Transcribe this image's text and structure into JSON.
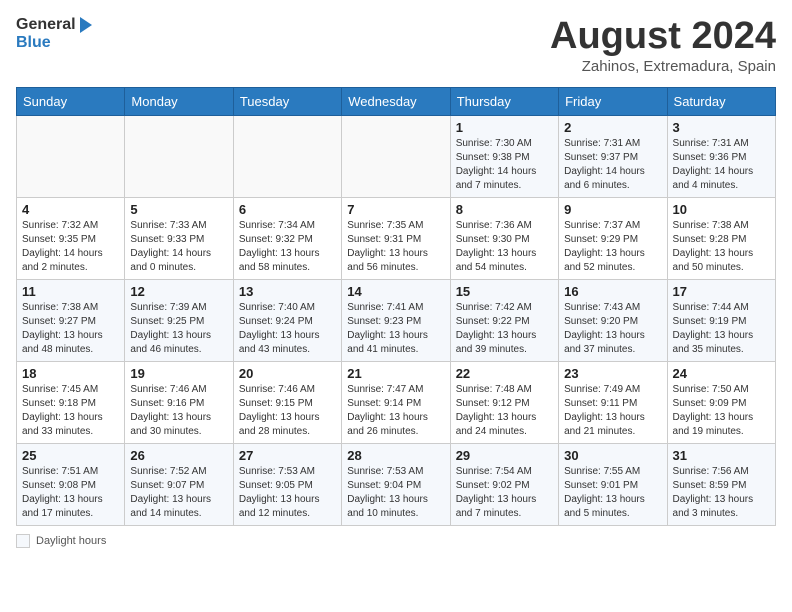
{
  "logo": {
    "general": "General",
    "blue": "Blue"
  },
  "title": {
    "month_year": "August 2024",
    "location": "Zahinos, Extremadura, Spain"
  },
  "days_of_week": [
    "Sunday",
    "Monday",
    "Tuesday",
    "Wednesday",
    "Thursday",
    "Friday",
    "Saturday"
  ],
  "weeks": [
    [
      {
        "day": "",
        "sunrise": "",
        "sunset": "",
        "daylight": ""
      },
      {
        "day": "",
        "sunrise": "",
        "sunset": "",
        "daylight": ""
      },
      {
        "day": "",
        "sunrise": "",
        "sunset": "",
        "daylight": ""
      },
      {
        "day": "",
        "sunrise": "",
        "sunset": "",
        "daylight": ""
      },
      {
        "day": "1",
        "sunrise": "Sunrise: 7:30 AM",
        "sunset": "Sunset: 9:38 PM",
        "daylight": "Daylight: 14 hours and 7 minutes."
      },
      {
        "day": "2",
        "sunrise": "Sunrise: 7:31 AM",
        "sunset": "Sunset: 9:37 PM",
        "daylight": "Daylight: 14 hours and 6 minutes."
      },
      {
        "day": "3",
        "sunrise": "Sunrise: 7:31 AM",
        "sunset": "Sunset: 9:36 PM",
        "daylight": "Daylight: 14 hours and 4 minutes."
      }
    ],
    [
      {
        "day": "4",
        "sunrise": "Sunrise: 7:32 AM",
        "sunset": "Sunset: 9:35 PM",
        "daylight": "Daylight: 14 hours and 2 minutes."
      },
      {
        "day": "5",
        "sunrise": "Sunrise: 7:33 AM",
        "sunset": "Sunset: 9:33 PM",
        "daylight": "Daylight: 14 hours and 0 minutes."
      },
      {
        "day": "6",
        "sunrise": "Sunrise: 7:34 AM",
        "sunset": "Sunset: 9:32 PM",
        "daylight": "Daylight: 13 hours and 58 minutes."
      },
      {
        "day": "7",
        "sunrise": "Sunrise: 7:35 AM",
        "sunset": "Sunset: 9:31 PM",
        "daylight": "Daylight: 13 hours and 56 minutes."
      },
      {
        "day": "8",
        "sunrise": "Sunrise: 7:36 AM",
        "sunset": "Sunset: 9:30 PM",
        "daylight": "Daylight: 13 hours and 54 minutes."
      },
      {
        "day": "9",
        "sunrise": "Sunrise: 7:37 AM",
        "sunset": "Sunset: 9:29 PM",
        "daylight": "Daylight: 13 hours and 52 minutes."
      },
      {
        "day": "10",
        "sunrise": "Sunrise: 7:38 AM",
        "sunset": "Sunset: 9:28 PM",
        "daylight": "Daylight: 13 hours and 50 minutes."
      }
    ],
    [
      {
        "day": "11",
        "sunrise": "Sunrise: 7:38 AM",
        "sunset": "Sunset: 9:27 PM",
        "daylight": "Daylight: 13 hours and 48 minutes."
      },
      {
        "day": "12",
        "sunrise": "Sunrise: 7:39 AM",
        "sunset": "Sunset: 9:25 PM",
        "daylight": "Daylight: 13 hours and 46 minutes."
      },
      {
        "day": "13",
        "sunrise": "Sunrise: 7:40 AM",
        "sunset": "Sunset: 9:24 PM",
        "daylight": "Daylight: 13 hours and 43 minutes."
      },
      {
        "day": "14",
        "sunrise": "Sunrise: 7:41 AM",
        "sunset": "Sunset: 9:23 PM",
        "daylight": "Daylight: 13 hours and 41 minutes."
      },
      {
        "day": "15",
        "sunrise": "Sunrise: 7:42 AM",
        "sunset": "Sunset: 9:22 PM",
        "daylight": "Daylight: 13 hours and 39 minutes."
      },
      {
        "day": "16",
        "sunrise": "Sunrise: 7:43 AM",
        "sunset": "Sunset: 9:20 PM",
        "daylight": "Daylight: 13 hours and 37 minutes."
      },
      {
        "day": "17",
        "sunrise": "Sunrise: 7:44 AM",
        "sunset": "Sunset: 9:19 PM",
        "daylight": "Daylight: 13 hours and 35 minutes."
      }
    ],
    [
      {
        "day": "18",
        "sunrise": "Sunrise: 7:45 AM",
        "sunset": "Sunset: 9:18 PM",
        "daylight": "Daylight: 13 hours and 33 minutes."
      },
      {
        "day": "19",
        "sunrise": "Sunrise: 7:46 AM",
        "sunset": "Sunset: 9:16 PM",
        "daylight": "Daylight: 13 hours and 30 minutes."
      },
      {
        "day": "20",
        "sunrise": "Sunrise: 7:46 AM",
        "sunset": "Sunset: 9:15 PM",
        "daylight": "Daylight: 13 hours and 28 minutes."
      },
      {
        "day": "21",
        "sunrise": "Sunrise: 7:47 AM",
        "sunset": "Sunset: 9:14 PM",
        "daylight": "Daylight: 13 hours and 26 minutes."
      },
      {
        "day": "22",
        "sunrise": "Sunrise: 7:48 AM",
        "sunset": "Sunset: 9:12 PM",
        "daylight": "Daylight: 13 hours and 24 minutes."
      },
      {
        "day": "23",
        "sunrise": "Sunrise: 7:49 AM",
        "sunset": "Sunset: 9:11 PM",
        "daylight": "Daylight: 13 hours and 21 minutes."
      },
      {
        "day": "24",
        "sunrise": "Sunrise: 7:50 AM",
        "sunset": "Sunset: 9:09 PM",
        "daylight": "Daylight: 13 hours and 19 minutes."
      }
    ],
    [
      {
        "day": "25",
        "sunrise": "Sunrise: 7:51 AM",
        "sunset": "Sunset: 9:08 PM",
        "daylight": "Daylight: 13 hours and 17 minutes."
      },
      {
        "day": "26",
        "sunrise": "Sunrise: 7:52 AM",
        "sunset": "Sunset: 9:07 PM",
        "daylight": "Daylight: 13 hours and 14 minutes."
      },
      {
        "day": "27",
        "sunrise": "Sunrise: 7:53 AM",
        "sunset": "Sunset: 9:05 PM",
        "daylight": "Daylight: 13 hours and 12 minutes."
      },
      {
        "day": "28",
        "sunrise": "Sunrise: 7:53 AM",
        "sunset": "Sunset: 9:04 PM",
        "daylight": "Daylight: 13 hours and 10 minutes."
      },
      {
        "day": "29",
        "sunrise": "Sunrise: 7:54 AM",
        "sunset": "Sunset: 9:02 PM",
        "daylight": "Daylight: 13 hours and 7 minutes."
      },
      {
        "day": "30",
        "sunrise": "Sunrise: 7:55 AM",
        "sunset": "Sunset: 9:01 PM",
        "daylight": "Daylight: 13 hours and 5 minutes."
      },
      {
        "day": "31",
        "sunrise": "Sunrise: 7:56 AM",
        "sunset": "Sunset: 8:59 PM",
        "daylight": "Daylight: 13 hours and 3 minutes."
      }
    ]
  ],
  "footer": {
    "daylight_label": "Daylight hours"
  }
}
